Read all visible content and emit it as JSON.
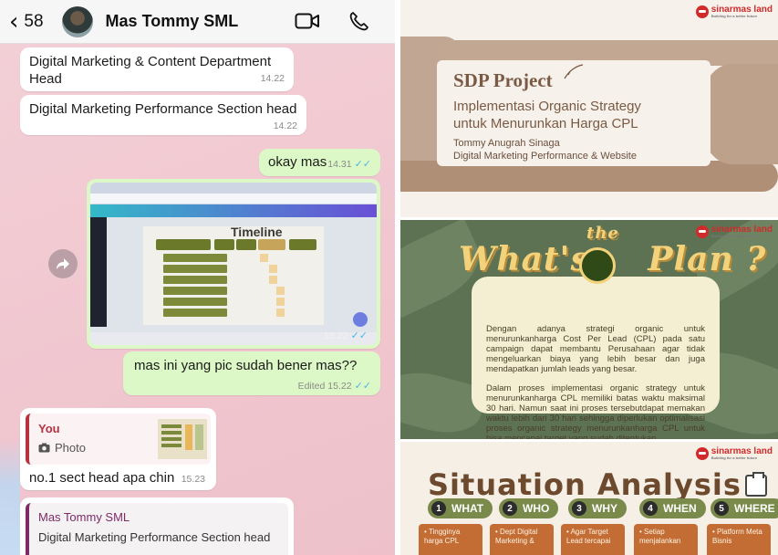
{
  "chat": {
    "header": {
      "back_count": "58",
      "contact_name": "Mas Tommy SML",
      "icons": [
        "chevron-left-icon",
        "video-call-icon",
        "phone-call-icon"
      ]
    },
    "messages": [
      {
        "from": "in",
        "text": "Digital Marketing & Content Department Head",
        "time": "14.22"
      },
      {
        "from": "in",
        "text": "Digital Marketing Performance Section head",
        "time": "14.22"
      },
      {
        "from": "out",
        "text": "okay mas",
        "time": "14.31"
      },
      {
        "from": "out",
        "type": "image",
        "time": "15.22",
        "image_caption": "Timeline",
        "image_headers": [
          "ACTIVITY",
          "START",
          "END",
          "PIC"
        ]
      },
      {
        "from": "out",
        "text": "mas ini yang pic sudah bener mas??",
        "time": "Edited 15.22"
      },
      {
        "from": "in",
        "reply_to_author": "You",
        "reply_to_content": "Photo",
        "text": "no.1 sect head apa chin",
        "time": "15.23"
      },
      {
        "from": "in",
        "reply_to_author": "Mas Tommy SML",
        "reply_to_content": "Digital Marketing Performance Section head"
      }
    ],
    "colors": {
      "chat_bg": "#f0c6cf",
      "bubble_out": "#dcf8c6",
      "bubble_in": "#ffffff",
      "read_ticks": "#4fb5e9"
    }
  },
  "slides": {
    "brand": {
      "name": "sinarmas land",
      "tagline": "Building for a better future"
    },
    "title_slide": {
      "title": "SDP Project",
      "subtitle_line1": "Implementasi Organic Strategy",
      "subtitle_line2": "untuk Menurunkan Harga CPL",
      "author": "Tommy Anugrah Sinaga",
      "role": "Digital Marketing Performance & Website"
    },
    "plan_slide": {
      "title_a": "What's",
      "title_the": "the",
      "title_b": "Plan ?",
      "para1": "Dengan adanya strategi organic untuk menurunkanharga Cost Per Lead (CPL) pada satu campaign dapat membantu Perusahaan agar tidak mengeluarkan biaya yang lebih besar dan juga mendapatkan jumlah leads yang besar.",
      "para2": "Dalam proses implementasi organic strategy untuk menurunkanharga CPL memiliki batas waktu maksimal 30 hari. Namun saat ini proses tersebutdapat memakan waktu lebih dari 30 hari sehingga diperlukan optimalisasi proses organic strategy menurunkanharga CPL untuk bisa mencapai target yang sudah ditentukan."
    },
    "situation_slide": {
      "title": "Situation Analysis",
      "pills": [
        {
          "num": "1",
          "label": "WHAT"
        },
        {
          "num": "2",
          "label": "WHO"
        },
        {
          "num": "3",
          "label": "WHY"
        },
        {
          "num": "4",
          "label": "WHEN"
        },
        {
          "num": "5",
          "label": "WHERE"
        }
      ],
      "boxes": [
        "• Tingginya harga CPL",
        "• Dept Digital Marketing &",
        "• Agar Target Lead tercapai",
        "• Setiap menjalankan",
        "• Platform Meta Bisnis"
      ]
    }
  }
}
